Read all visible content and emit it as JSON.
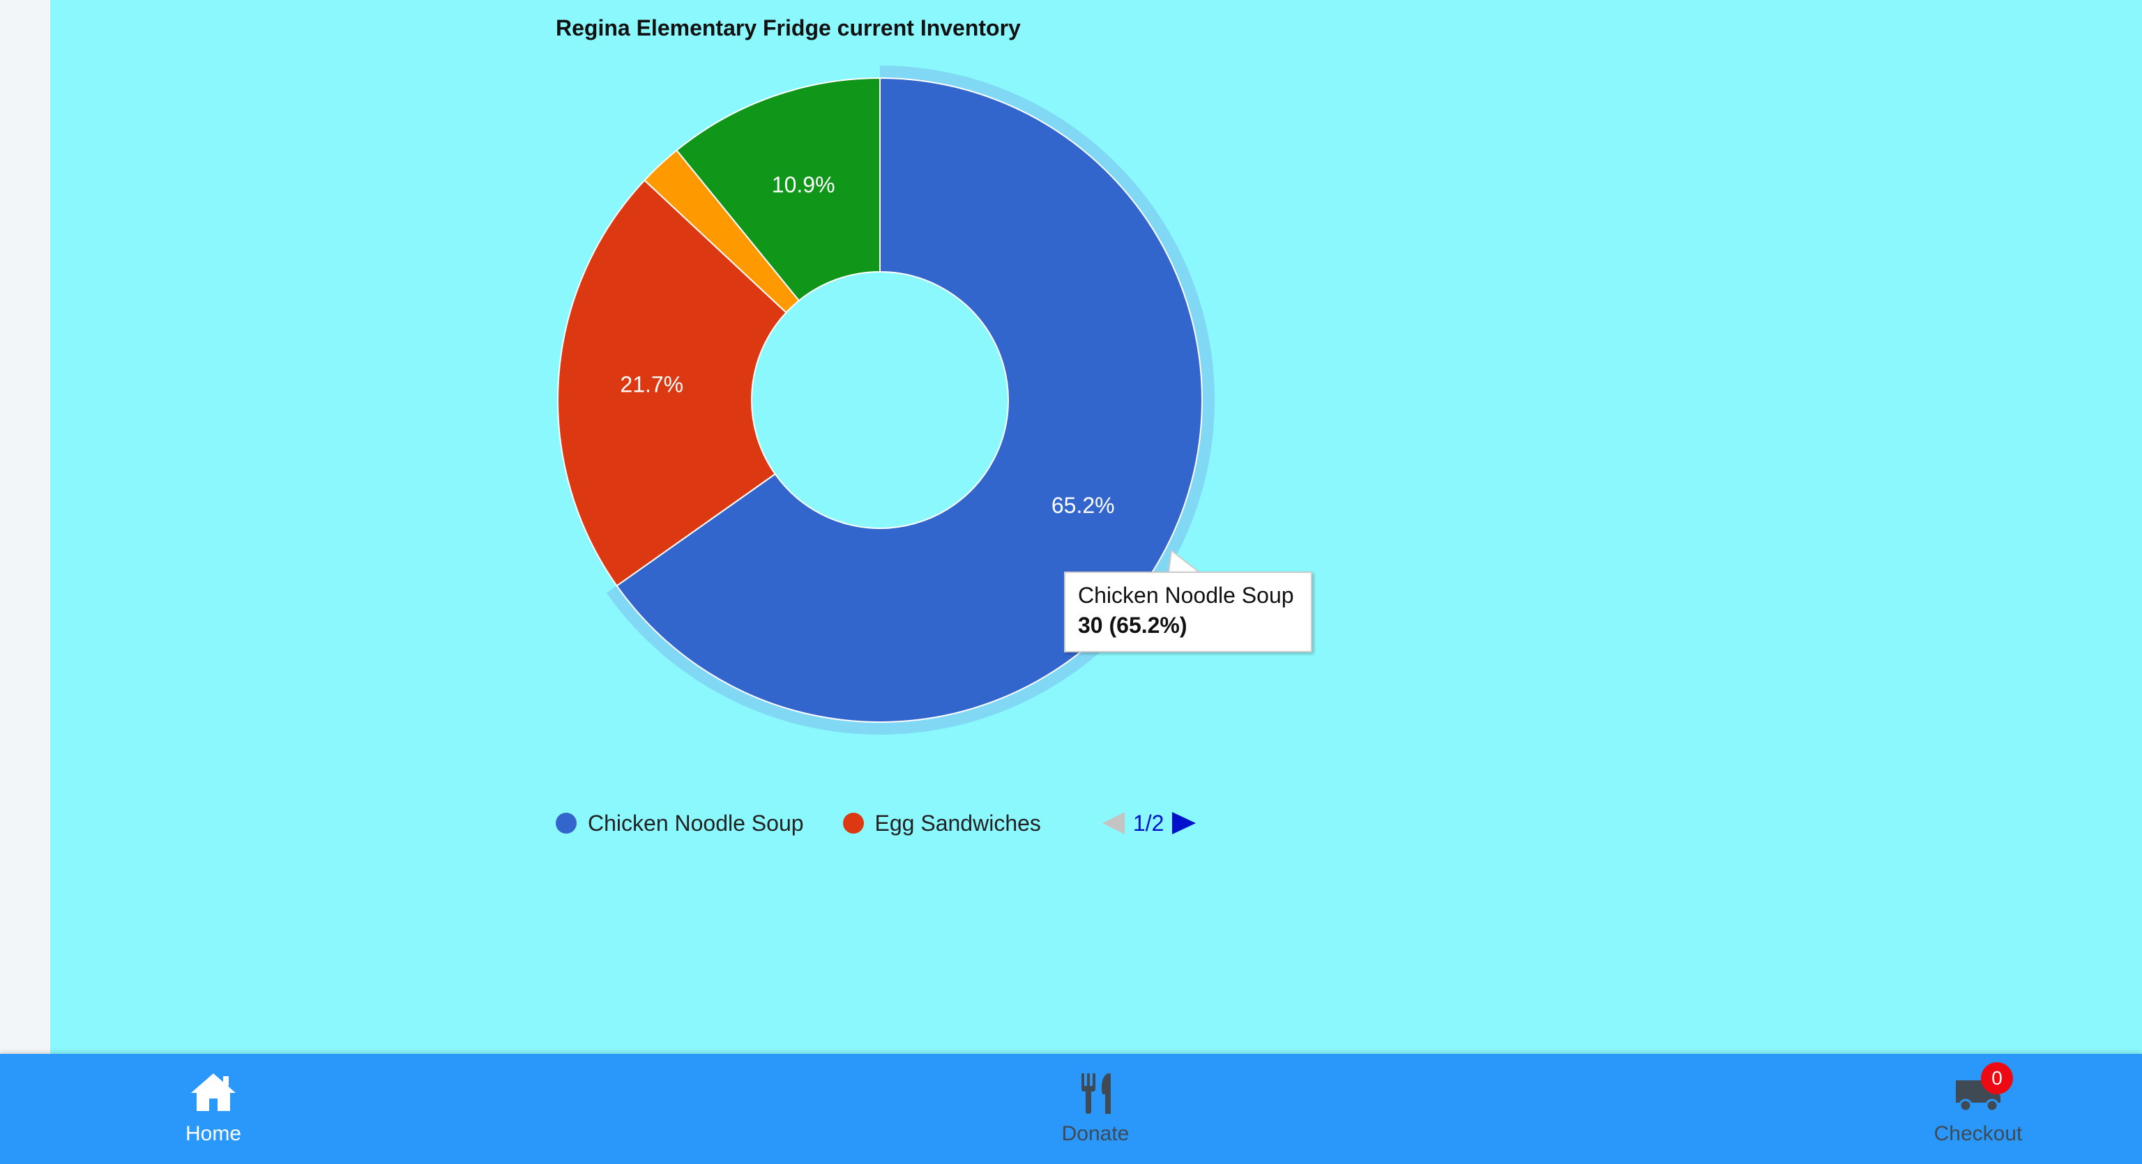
{
  "chart_data": {
    "type": "pie",
    "title": "Regina Elementary Fridge current Inventory",
    "slices": [
      {
        "label": "Chicken Noodle Soup",
        "value": 30,
        "percent_label": "65.2%",
        "color": "#3366cc"
      },
      {
        "label": "Egg Sandwiches",
        "value": 10,
        "percent_label": "21.7%",
        "color": "#dc3912"
      },
      {
        "value": 1,
        "color": "#ff9900"
      },
      {
        "value": 5,
        "percent_label": "10.9%",
        "color": "#109618"
      }
    ],
    "donut": true,
    "highlighted_slice": "Chicken Noodle Soup",
    "legend_position": "bottom",
    "legend_visible": [
      "Chicken Noodle Soup",
      "Egg Sandwiches"
    ]
  },
  "legend": {
    "items": [
      {
        "label": "Chicken Noodle Soup",
        "color": "#3366cc"
      },
      {
        "label": "Egg Sandwiches",
        "color": "#dc3912"
      }
    ],
    "page_indicator": "1/2"
  },
  "tooltip": {
    "title": "Chicken Noodle Soup",
    "value": "30 (65.2%)"
  },
  "bottom_nav": {
    "home": {
      "label": "Home",
      "icon": "home-icon"
    },
    "donate": {
      "label": "Donate",
      "icon": "utensils-icon"
    },
    "checkout": {
      "label": "Checkout",
      "icon": "truck-icon",
      "badge": "0"
    }
  },
  "colors": {
    "background": "#8af8fc",
    "nav_bar": "#2998fa",
    "badge": "#ee0a12"
  }
}
